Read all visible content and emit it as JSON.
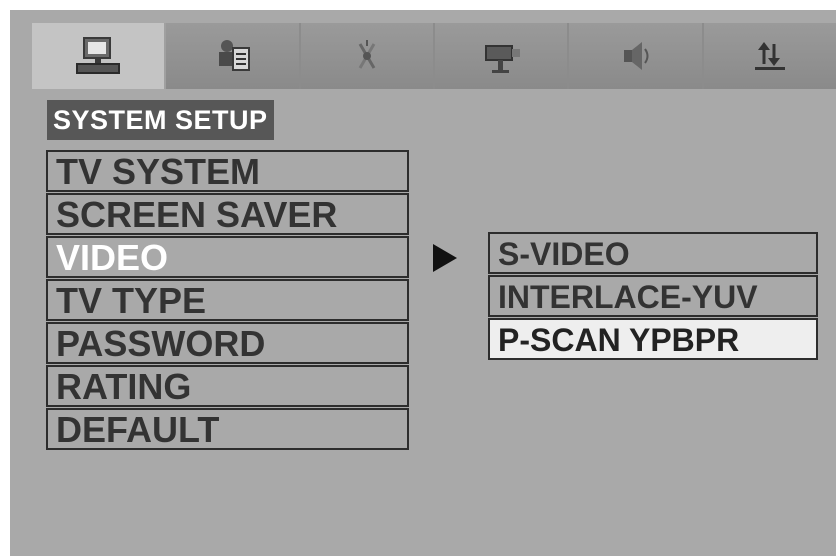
{
  "tabs": [
    {
      "icon": "monitor-icon",
      "active": true
    },
    {
      "icon": "language-icon",
      "active": false
    },
    {
      "icon": "audio-satellite-icon",
      "active": false
    },
    {
      "icon": "camera-icon",
      "active": false
    },
    {
      "icon": "speaker-icon",
      "active": false
    },
    {
      "icon": "exit-arrows-icon",
      "active": false
    }
  ],
  "section_title": "SYSTEM SETUP",
  "menu": {
    "items": [
      {
        "label": "TV SYSTEM"
      },
      {
        "label": "SCREEN SAVER"
      },
      {
        "label": "VIDEO"
      },
      {
        "label": "TV TYPE"
      },
      {
        "label": "PASSWORD"
      },
      {
        "label": "RATING"
      },
      {
        "label": "DEFAULT"
      }
    ],
    "selected": "VIDEO"
  },
  "submenu": {
    "items": [
      {
        "label": "S-VIDEO"
      },
      {
        "label": "INTERLACE-YUV"
      },
      {
        "label": "P-SCAN YPBPR"
      }
    ],
    "selected": "P-SCAN YPBPR"
  },
  "colors": {
    "background": "#a9a9a9",
    "title_bg": "#575757",
    "highlight": "#eeeeee"
  }
}
